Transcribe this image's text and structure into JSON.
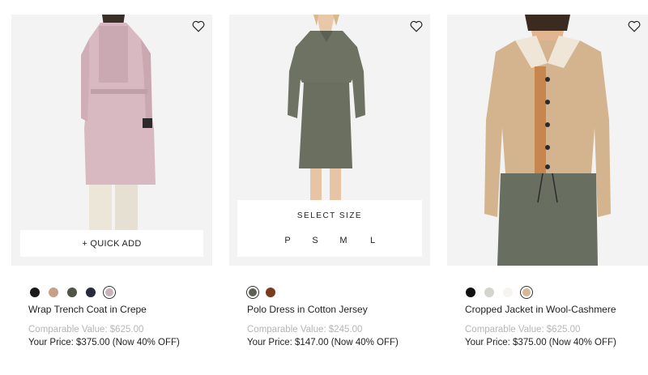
{
  "products": [
    {
      "name": "Wrap Trench Coat in Crepe",
      "comparable_value": "Comparable Value: $625.00",
      "your_price": "Your Price: $375.00 (Now 40% OFF)",
      "quick_add_label": "+ QUICK ADD",
      "swatches": [
        {
          "name": "black",
          "color": "#1a1a1a"
        },
        {
          "name": "camel",
          "color": "#c8a08a"
        },
        {
          "name": "olive",
          "color": "#4f5446"
        },
        {
          "name": "navy",
          "color": "#252a3c"
        },
        {
          "name": "pink",
          "color": "#c9b2b8",
          "selected": true
        }
      ]
    },
    {
      "name": "Polo Dress in Cotton Jersey",
      "comparable_value": "Comparable Value: $245.00",
      "your_price": "Your Price: $147.00 (Now 40% OFF)",
      "select_size_label": "SELECT SIZE",
      "sizes": [
        "P",
        "S",
        "M",
        "L"
      ],
      "swatches": [
        {
          "name": "olive",
          "color": "#5c6152",
          "selected": true
        },
        {
          "name": "brown",
          "color": "#7a3b1e"
        }
      ]
    },
    {
      "name": "Cropped Jacket in Wool-Cashmere",
      "comparable_value": "Comparable Value: $625.00",
      "your_price": "Your Price: $375.00 (Now 40% OFF)",
      "swatches": [
        {
          "name": "black",
          "color": "#111111"
        },
        {
          "name": "light-grey",
          "color": "#d4d4cc"
        },
        {
          "name": "white",
          "color": "#f6f4f0"
        },
        {
          "name": "camel",
          "color": "#d6b894",
          "selected": true
        }
      ]
    }
  ]
}
